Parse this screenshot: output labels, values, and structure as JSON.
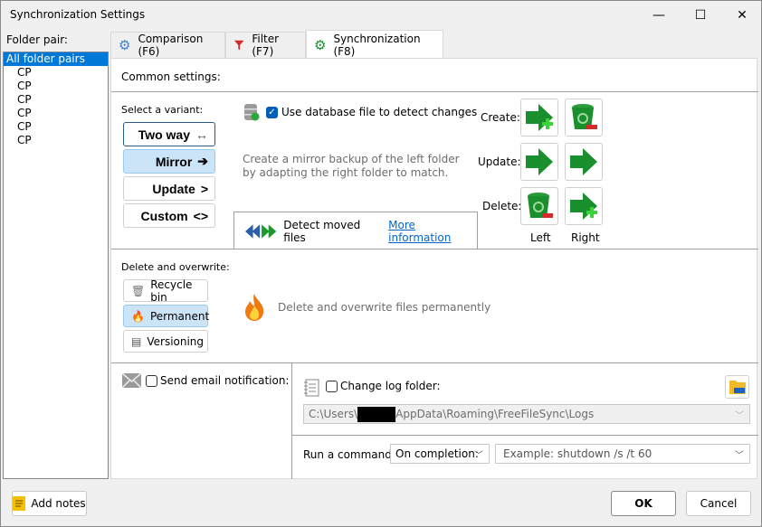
{
  "window": {
    "title": "Synchronization Settings",
    "minimize": "—",
    "maximize": "☐",
    "close": "✕"
  },
  "left": {
    "label": "Folder pair:",
    "items": [
      "All folder pairs",
      "CP",
      "CP",
      "CP",
      "CP",
      "CP",
      "CP"
    ]
  },
  "tabs": [
    {
      "label": "Comparison (F6)",
      "icon": "gear-icon"
    },
    {
      "label": "Filter (F7)",
      "icon": "filter-icon"
    },
    {
      "label": "Synchronization (F8)",
      "icon": "gear-icon",
      "active": true
    }
  ],
  "common": {
    "label": "Common settings:"
  },
  "variant": {
    "label": "Select a variant:",
    "options": [
      {
        "label": "Two way",
        "glyph": "↔"
      },
      {
        "label": "Mirror",
        "glyph": "➔",
        "selected": true
      },
      {
        "label": "Update",
        "glyph": ">"
      },
      {
        "label": "Custom",
        "glyph": "<>"
      }
    ]
  },
  "database": {
    "label": "Use database file to detect changes",
    "checked": true
  },
  "description": "Create a mirror backup of the left folder by adapting the right folder to match.",
  "moved": {
    "label": "Detect moved files",
    "link": "More information"
  },
  "actions": {
    "create": "Create:",
    "update": "Update:",
    "delete": "Delete:",
    "left": "Left",
    "right": "Right"
  },
  "deletion": {
    "label": "Delete and overwrite:",
    "options": [
      {
        "label": "Recycle bin"
      },
      {
        "label": "Permanent",
        "selected": true
      },
      {
        "label": "Versioning"
      }
    ],
    "description": "Delete and overwrite files permanently"
  },
  "email": {
    "label": "Send email notification:",
    "checked": false
  },
  "log": {
    "label": "Change log folder:",
    "checked": false,
    "path_prefix": "C:\\Users\\",
    "path_suffix": "AppData\\Roaming\\FreeFileSync\\Logs"
  },
  "command": {
    "label": "Run a command:",
    "when": "On completion:",
    "placeholder": "Example: shutdown /s /t 60"
  },
  "footer": {
    "add_notes": "Add notes",
    "ok": "OK",
    "cancel": "Cancel"
  },
  "colors": {
    "accent": "#0078d7",
    "selected": "#cce4f7",
    "green": "#1a8f2e"
  }
}
